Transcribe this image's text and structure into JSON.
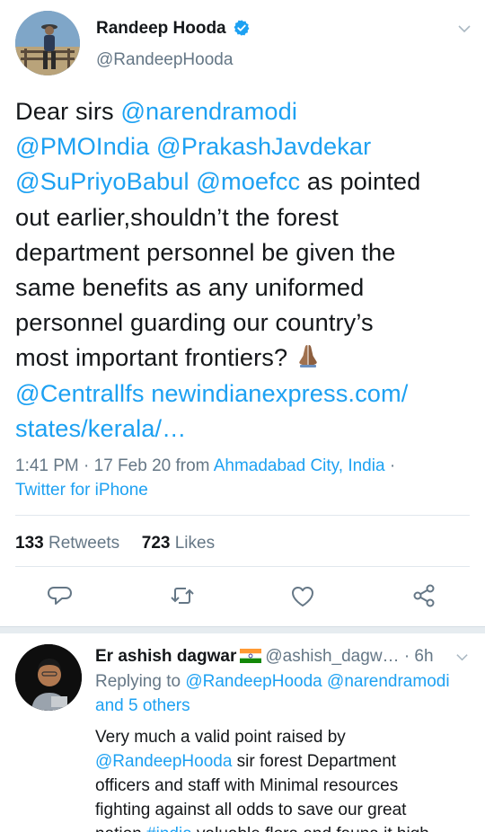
{
  "tweet": {
    "author_name": "Randeep Hooda",
    "author_handle": "@RandeepHooda",
    "text": {
      "l1_a": "Dear sirs ",
      "l1_b": "@narendramodi",
      "l2_a": "@PMOIndia",
      "l2_b": " ",
      "l2_c": "@PrakashJavdekar",
      "l3_a": "@SuPriyoBabul",
      "l3_b": " ",
      "l3_c": "@moefcc",
      "l3_d": " as pointed",
      "l4": "out earlier,shouldn’t the forest",
      "l5": "department personnel be given the",
      "l6": "same benefits as any uniformed",
      "l7": "personnel guarding our country’s",
      "l8": "most important frontiers? ",
      "l9_a": "@Centrallfs",
      "l9_b": " ",
      "l9_c": "newindianexpress.com/",
      "l10": "states/kerala/…"
    },
    "meta": {
      "time_date": "1:41 PM · 17 Feb 20 from ",
      "location": "Ahmadabad City, India",
      "dot": " ·",
      "source": "Twitter for iPhone"
    },
    "stats": {
      "retweets_count": "133",
      "retweets_label": " Retweets",
      "likes_count": "723",
      "likes_label": " Likes"
    }
  },
  "reply": {
    "author_name": "Er ashish dagwar",
    "author_handle": "@ashish_dagw…",
    "time": " · 6h",
    "replying_prefix": "Replying to ",
    "replying_user1": "@RandeepHooda",
    "replying_user2": "@narendramodi",
    "replying_others": "and 5 others",
    "body": {
      "l1": "Very much a valid point raised by",
      "l2_a": "@RandeepHooda",
      "l2_b": " sir forest Department",
      "l3": "officers and staff with Minimal resources",
      "l4": "fighting against all odds  to save our great",
      "l5_a": "nation ",
      "l5_b": "#india",
      "l5_c": " valuable flora and fauna it high"
    }
  },
  "icons": [
    "verified-badge-icon",
    "chevron-down-icon",
    "folded-hands-emoji",
    "reply-icon",
    "retweet-icon",
    "like-icon",
    "share-icon",
    "india-flag-icon"
  ],
  "colors": {
    "accent": "#1da1f2",
    "secondary_text": "#657786",
    "primary_text": "#14171a",
    "divider": "#e1e8ed"
  }
}
